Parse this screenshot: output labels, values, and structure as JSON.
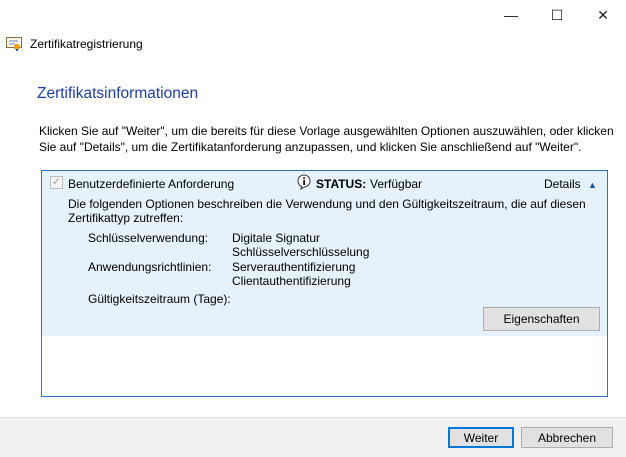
{
  "window": {
    "title": "Zertifikatregistrierung",
    "minimize": "—",
    "maximize": "☐",
    "close": "✕"
  },
  "heading": "Zertifikatsinformationen",
  "intro": "Klicken Sie auf \"Weiter\", um die bereits für diese Vorlage ausgewählten Optionen auszuwählen, oder klicken Sie auf \"Details\", um die Zertifikatanforderung anzupassen, und klicken Sie anschließend auf \"Weiter\".",
  "request": {
    "name": "Benutzerdefinierte Anforderung",
    "checked": true,
    "status_label": "STATUS:",
    "status_value": "Verfügbar",
    "details": "Details",
    "description": "Die folgenden Optionen beschreiben die Verwendung und den Gültigkeitszeitraum, die auf diesen Zertifikattyp zutreffen:",
    "key_usage_label": "Schlüsselverwendung:",
    "key_usage": [
      "Digitale Signatur",
      "Schlüsselverschlüsselung"
    ],
    "app_policies_label": "Anwendungsrichtlinien:",
    "app_policies": [
      "Serverauthentifizierung",
      "Clientauthentifizierung"
    ],
    "validity_label": "Gültigkeitszeitraum (Tage):",
    "properties": "Eigenschaften"
  },
  "footer": {
    "next": "Weiter",
    "cancel": "Abbrechen"
  }
}
